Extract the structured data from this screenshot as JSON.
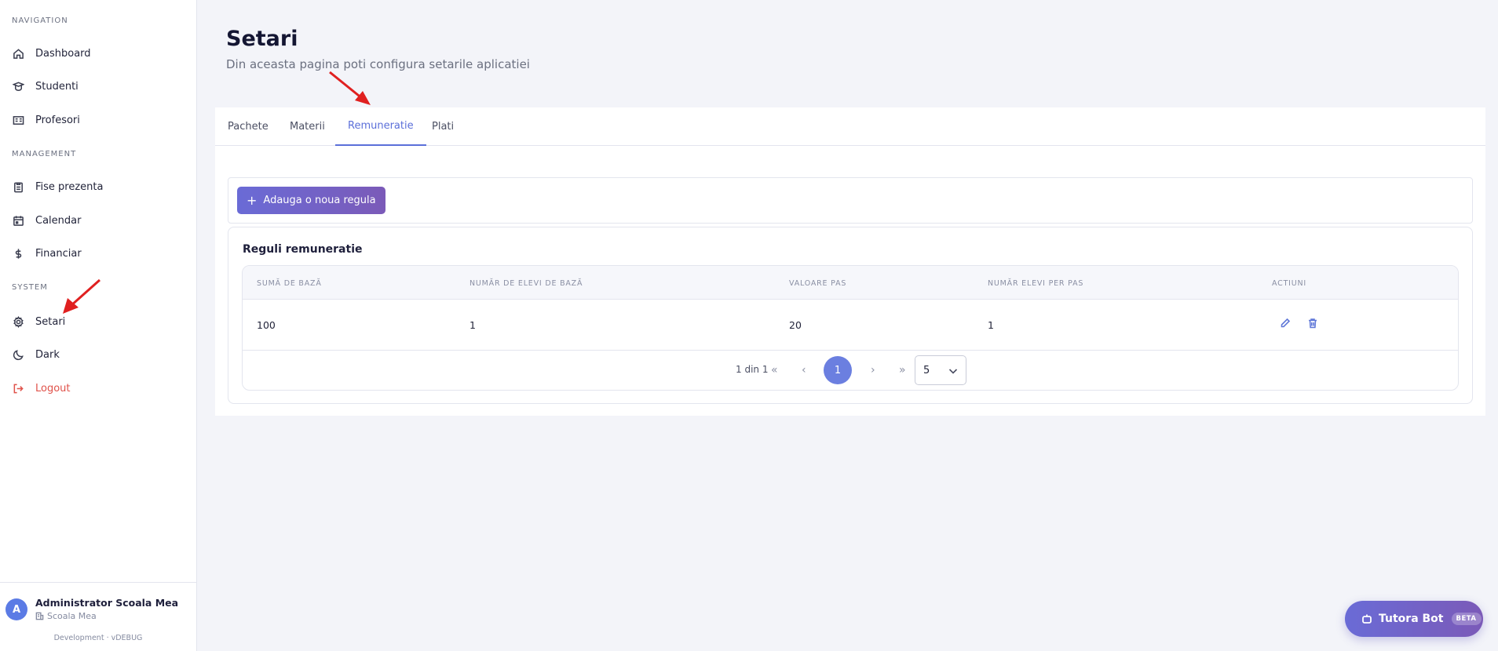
{
  "sidebar": {
    "sections": {
      "navigation": "NAVIGATION",
      "management": "MANAGEMENT",
      "system": "SYSTEM"
    },
    "items": [
      {
        "label": "Dashboard",
        "icon": "home-icon"
      },
      {
        "label": "Studenti",
        "icon": "student-icon"
      },
      {
        "label": "Profesori",
        "icon": "teacher-icon"
      },
      {
        "label": "Fise prezenta",
        "icon": "clipboard-icon"
      },
      {
        "label": "Calendar",
        "icon": "calendar-icon"
      },
      {
        "label": "Financiar",
        "icon": "dollar-icon"
      },
      {
        "label": "Setari",
        "icon": "gear-icon"
      },
      {
        "label": "Dark",
        "icon": "moon-icon"
      },
      {
        "label": "Logout",
        "icon": "logout-icon"
      }
    ],
    "footer": {
      "avatar_letter": "A",
      "user_name": "Administrator Scoala Mea",
      "school": "Scoala Mea",
      "env": "Development · vDEBUG"
    }
  },
  "header": {
    "title": "Setari",
    "subtitle": "Din aceasta pagina poti configura setarile aplicatiei"
  },
  "tabs": [
    {
      "label": "Pachete",
      "active": false
    },
    {
      "label": "Materii",
      "active": false
    },
    {
      "label": "Remuneratie",
      "active": true
    },
    {
      "label": "Plati",
      "active": false
    }
  ],
  "actions": {
    "add_button": "Adauga o noua regula"
  },
  "table": {
    "title": "Reguli remuneratie",
    "columns": [
      "SUMĂ DE BAZĂ",
      "NUMĂR DE ELEVI DE BAZĂ",
      "VALOARE PAS",
      "NUMĂR ELEVI PER PAS",
      "ACTIUNI"
    ],
    "rows": [
      [
        "100",
        "1",
        "20",
        "1"
      ]
    ]
  },
  "pagination": {
    "info": "1 din 1",
    "first": "«",
    "prev": "‹",
    "current": "1",
    "next": "›",
    "last": "»",
    "page_size": "5"
  },
  "bot": {
    "label": "Tutora Bot",
    "badge": "BETA"
  },
  "colors": {
    "accent": "#5b6fd9",
    "danger": "#e0524a",
    "annotation": "#e02020"
  }
}
